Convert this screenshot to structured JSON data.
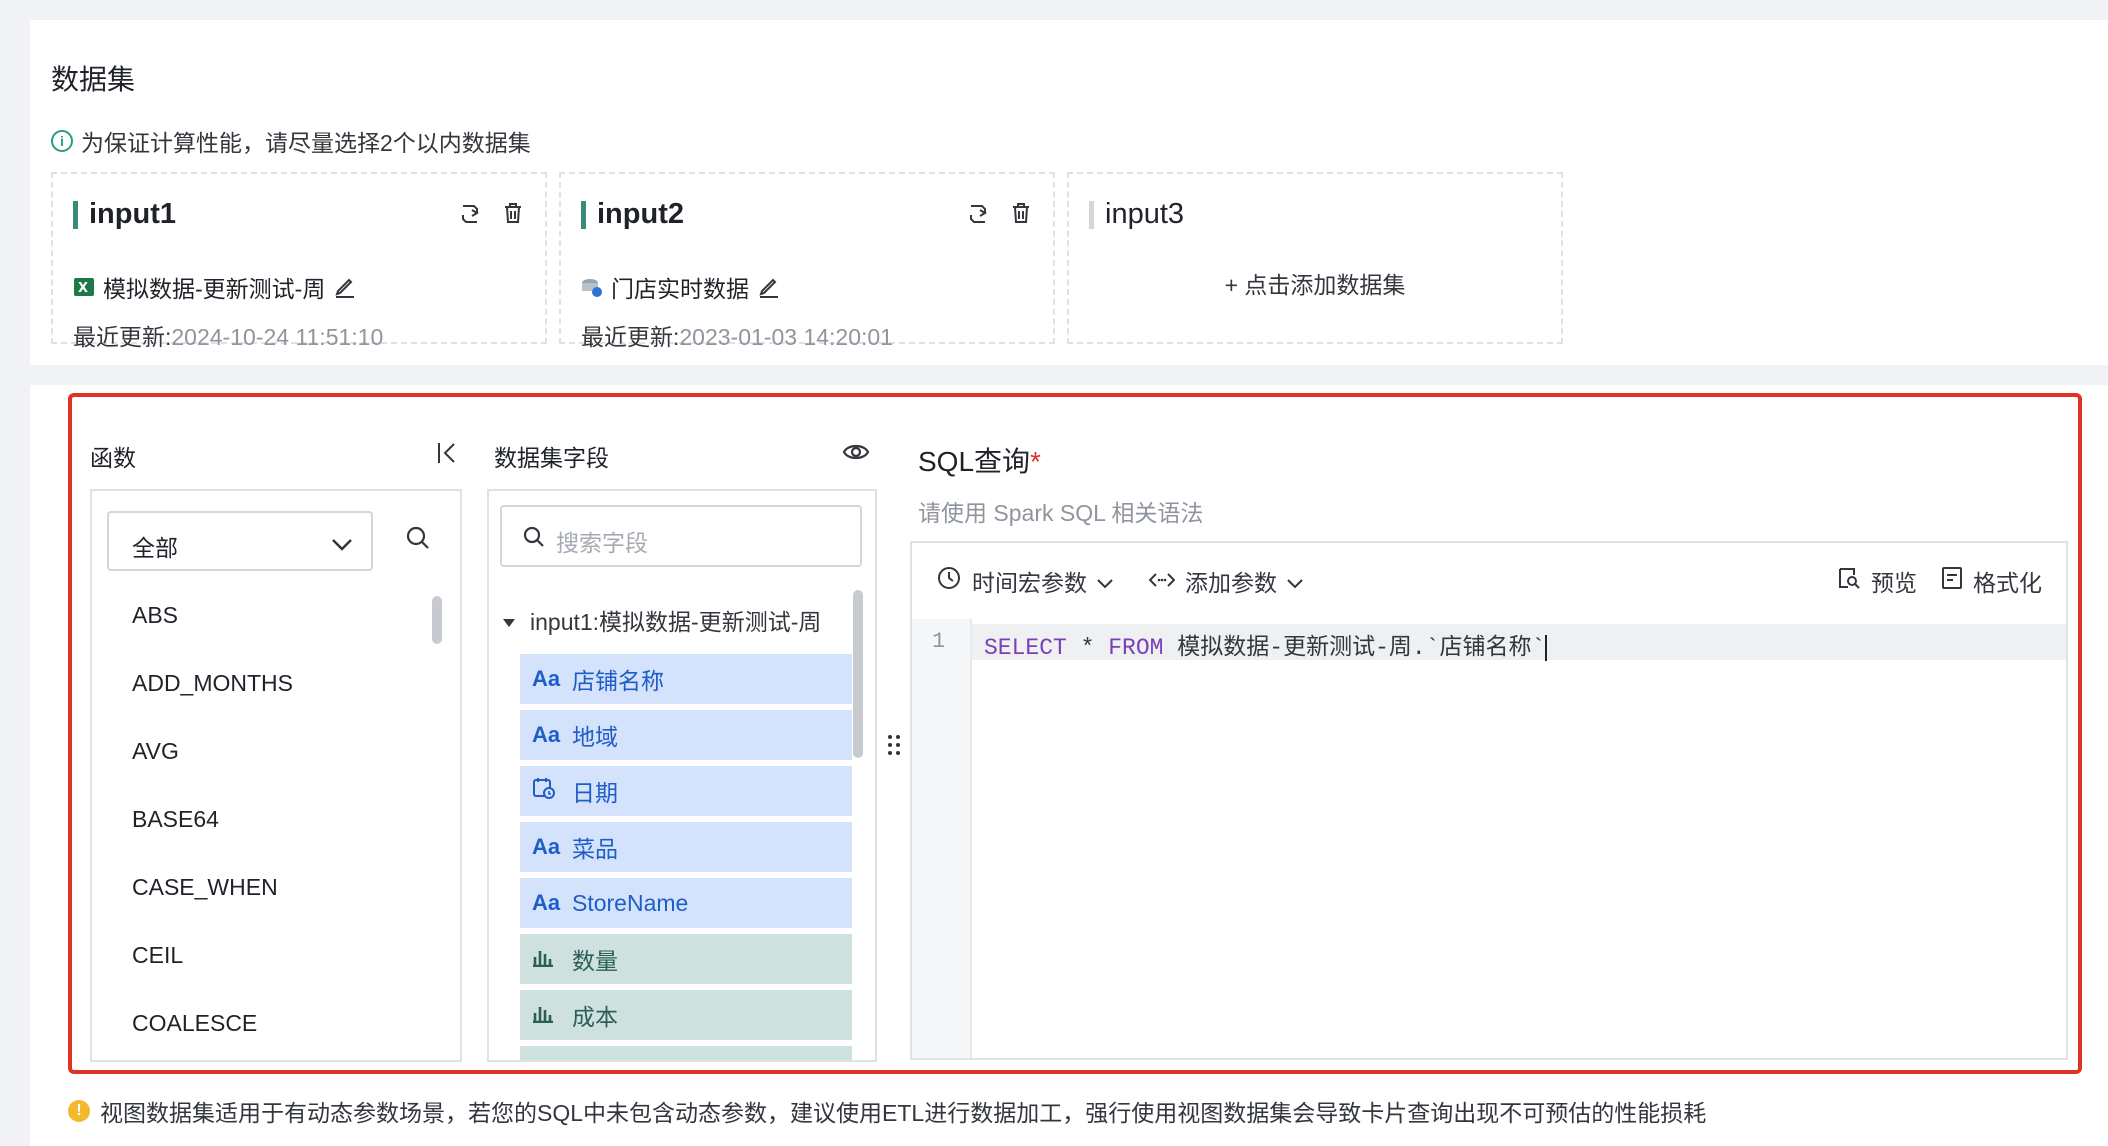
{
  "dataset": {
    "title": "数据集",
    "hint": "为保证计算性能，请尽量选择2个以内数据集",
    "cards": [
      {
        "title": "input1",
        "source_name": "模拟数据-更新测试-周",
        "updated_label": "最近更新:",
        "updated_time": "2024-10-24 11:51:10"
      },
      {
        "title": "input2",
        "source_name": "门店实时数据",
        "updated_label": "最近更新:",
        "updated_time": "2023-01-03 14:20:01"
      },
      {
        "title": "input3",
        "add_label": "+ 点击添加数据集"
      }
    ]
  },
  "functions": {
    "header": "函数",
    "category": "全部",
    "items": [
      "ABS",
      "ADD_MONTHS",
      "AVG",
      "BASE64",
      "CASE_WHEN",
      "CEIL",
      "COALESCE"
    ]
  },
  "fields": {
    "header": "数据集字段",
    "search_placeholder": "搜索字段",
    "tree_title": "input1:模拟数据-更新测试-周",
    "items": [
      {
        "label": "店铺名称",
        "glyph": "Aa"
      },
      {
        "label": "地域",
        "glyph": "Aa"
      },
      {
        "label": "日期",
        "glyph": "date"
      },
      {
        "label": "菜品",
        "glyph": "Aa"
      },
      {
        "label": "StoreName",
        "glyph": "Aa"
      },
      {
        "label": "数量",
        "glyph": "measure"
      },
      {
        "label": "成本",
        "glyph": "measure"
      }
    ]
  },
  "sql": {
    "title": "SQL查询",
    "required_mark": "*",
    "subtitle": "请使用 Spark SQL 相关语法",
    "toolbar": {
      "time_macro": "时间宏参数",
      "add_param": "添加参数",
      "preview": "预览",
      "format": "格式化"
    },
    "line_number": "1",
    "code_kw1": "SELECT",
    "code_star": " * ",
    "code_kw2": "FROM",
    "code_rest": " 模拟数据-更新测试-周.`店铺名称`"
  },
  "warning": "视图数据集适用于有动态参数场景，若您的SQL中未包含动态参数，建议使用ETL进行数据加工，强行使用视图数据集会导致卡片查询出现不可预估的性能损耗",
  "colors": {
    "accent": "#3a8a7b",
    "highlight": "#e03326",
    "dimension_bg": "#d4e2fb",
    "measure_bg": "#cfe1df"
  }
}
